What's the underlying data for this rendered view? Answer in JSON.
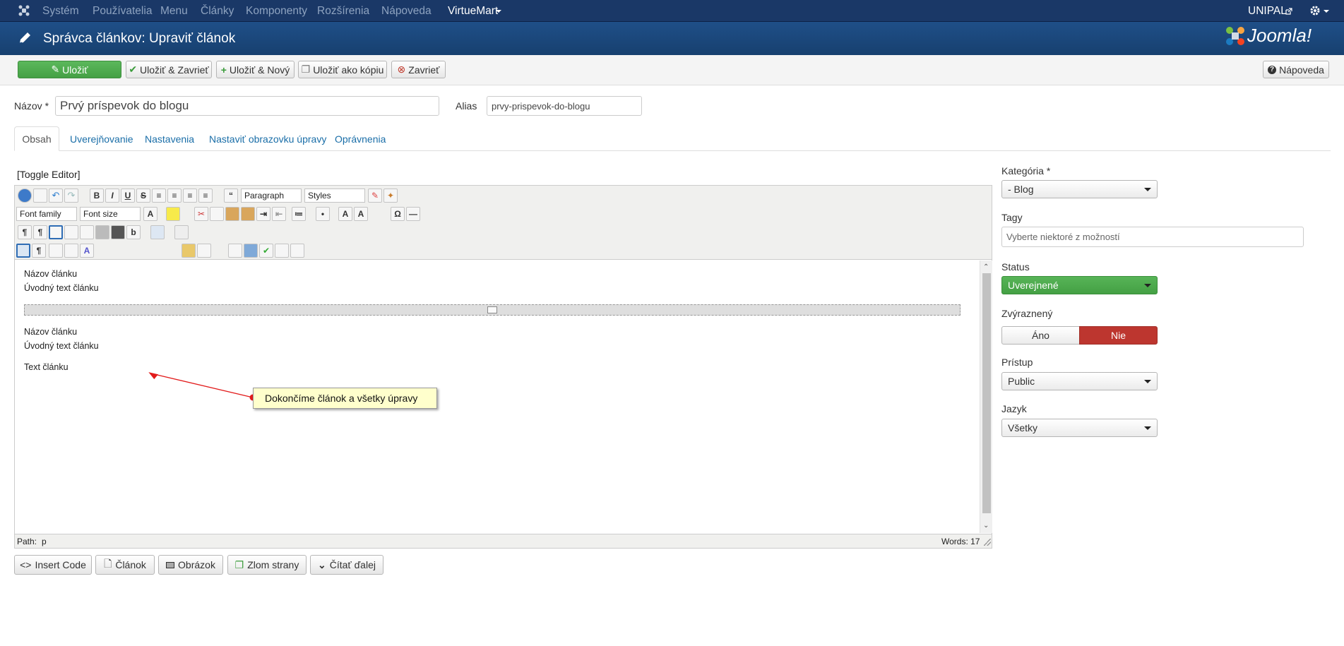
{
  "topnav": {
    "items": [
      "Systém",
      "Používatelia",
      "Menu",
      "Články",
      "Komponenty",
      "Rozšírenia",
      "Nápoveda",
      "VirtueMart"
    ],
    "user": "UNIPAL"
  },
  "titlebar": {
    "title": "Správca článkov: Upraviť článok",
    "brand": "Joomla!"
  },
  "toolbar": {
    "save": "Uložiť",
    "save_close": "Uložiť & Zavrieť",
    "save_new": "Uložiť & Nový",
    "save_copy": "Uložiť ako kópiu",
    "close": "Zavrieť",
    "help": "Nápoveda"
  },
  "form": {
    "title_label": "Názov *",
    "title_value": "Prvý príspevok do blogu",
    "alias_label": "Alias",
    "alias_value": "prvy-prispevok-do-blogu"
  },
  "tabs": [
    "Obsah",
    "Uverejňovanie",
    "Nastavenia",
    "Nastaviť obrazovku úpravy",
    "Oprávnenia"
  ],
  "editor": {
    "toggle": "[Toggle Editor]",
    "format_select": "Paragraph",
    "styles_select": "Styles",
    "font_family": "Font family",
    "font_size": "Font size",
    "content": [
      "Názov článku",
      "Úvodný text článku",
      "Názov článku",
      "Úvodný text článku",
      "Text článku"
    ],
    "path_label": "Path:",
    "path_value": "p",
    "words": "Words: 17"
  },
  "callout": "Dokončíme článok a všetky úpravy",
  "bottom_buttons": [
    "Insert Code",
    "Článok",
    "Obrázok",
    "Zlom strany",
    "Čítať ďalej"
  ],
  "sidebar": {
    "category_label": "Kategória *",
    "category_value": "- Blog",
    "tags_label": "Tagy",
    "tags_placeholder": "Vyberte niektoré z možností",
    "status_label": "Status",
    "status_value": "Uverejnené",
    "featured_label": "Zvýraznený",
    "featured_yes": "Áno",
    "featured_no": "Nie",
    "access_label": "Prístup",
    "access_value": "Public",
    "language_label": "Jazyk",
    "language_value": "Všetky"
  },
  "colors": {
    "nav": "#1a3867",
    "title": "#1b4a82",
    "green": "#46a546",
    "red": "#bd362f",
    "link": "#1a6ea8"
  }
}
